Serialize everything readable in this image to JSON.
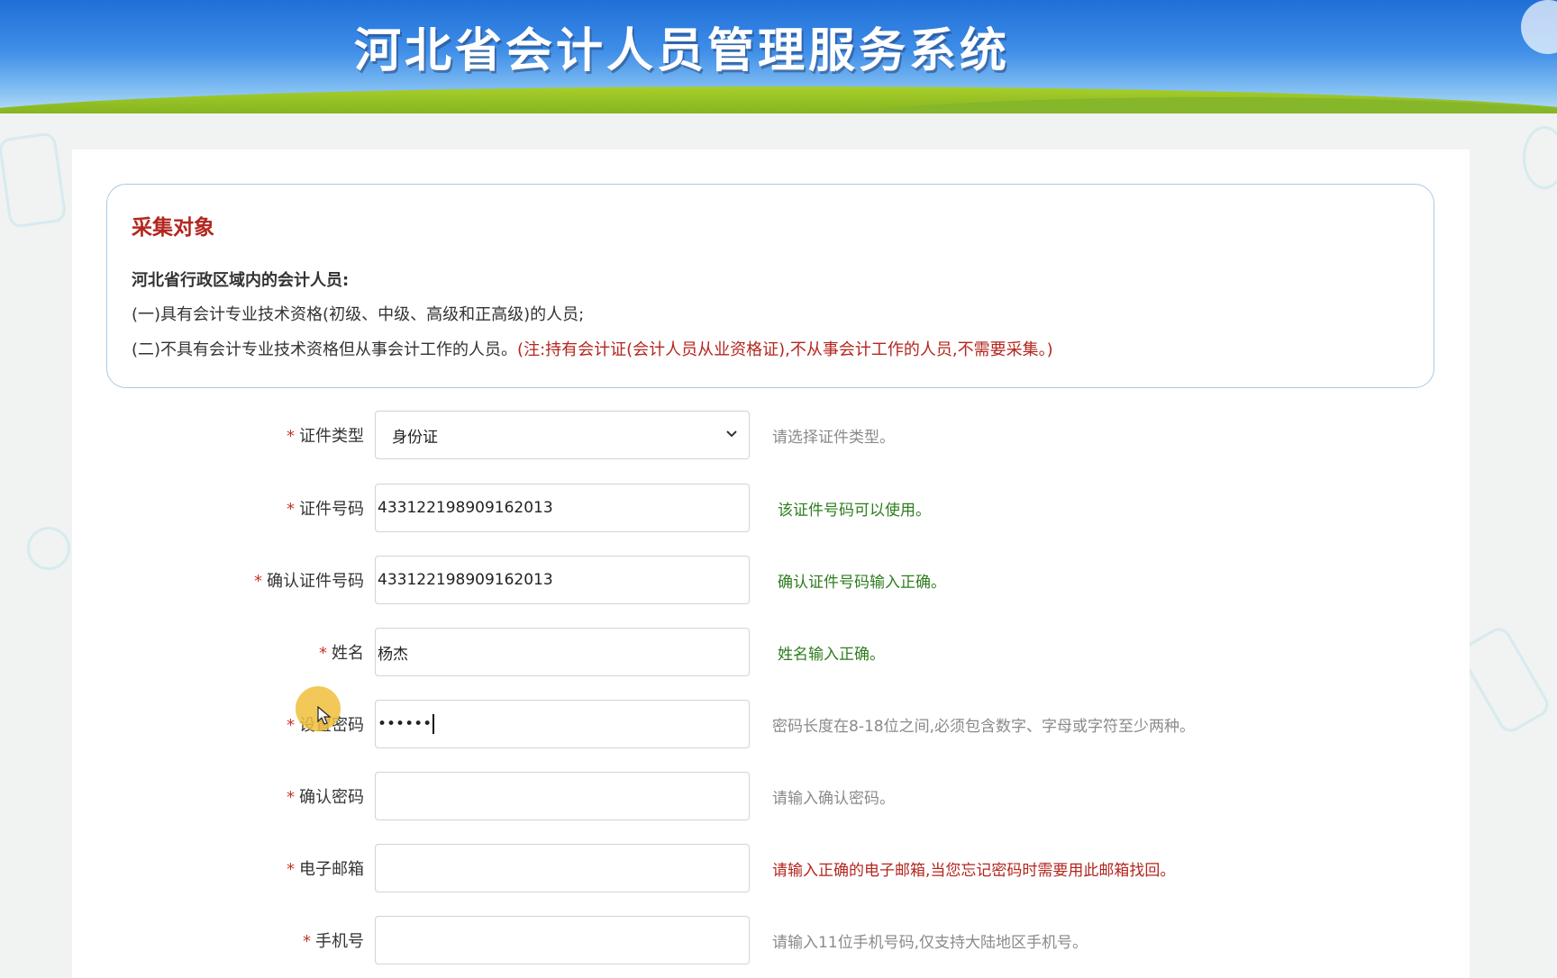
{
  "header": {
    "title": "河北省会计人员管理服务系统"
  },
  "notice": {
    "title": "采集对象",
    "subtitle": "河北省行政区域内的会计人员:",
    "line1": "(一)具有会计专业技术资格(初级、中级、高级和正高级)的人员;",
    "line2_prefix": "(二)不具有会计专业技术资格但从事会计工作的人员。",
    "line2_note": "(注:持有会计证(会计人员从业资格证),不从事会计工作的人员,不需要采集。)"
  },
  "form": {
    "required_mark": "*",
    "rows": [
      {
        "label": "证件类型",
        "value": "身份证",
        "hint": "请选择证件类型。",
        "hint_tone": "gray"
      },
      {
        "label": "证件号码",
        "value": "433122198909162013",
        "hint": "该证件号码可以使用。",
        "hint_tone": "green"
      },
      {
        "label": "确认证件号码",
        "value": "433122198909162013",
        "hint": "确认证件号码输入正确。",
        "hint_tone": "green"
      },
      {
        "label": "姓名",
        "value": "杨杰",
        "hint": "姓名输入正确。",
        "hint_tone": "green"
      },
      {
        "label": "设置密码",
        "value": "••••••",
        "hint": "密码长度在8-18位之间,必须包含数字、字母或字符至少两种。",
        "hint_tone": "gray"
      },
      {
        "label": "确认密码",
        "value": "",
        "hint": "请输入确认密码。",
        "hint_tone": "gray"
      },
      {
        "label": "电子邮箱",
        "value": "",
        "hint": "请输入正确的电子邮箱,当您忘记密码时需要用此邮箱找回。",
        "hint_tone": "red"
      },
      {
        "label": "手机号",
        "value": "",
        "hint": "请输入11位手机号码,仅支持大陆地区手机号。",
        "hint_tone": "gray"
      }
    ]
  },
  "colors": {
    "accent_red": "#b3261e",
    "ok_green": "#2e7d1e",
    "hint_gray": "#8a8a8a"
  },
  "icons": {
    "select_arrow": "chevron-down-icon"
  }
}
